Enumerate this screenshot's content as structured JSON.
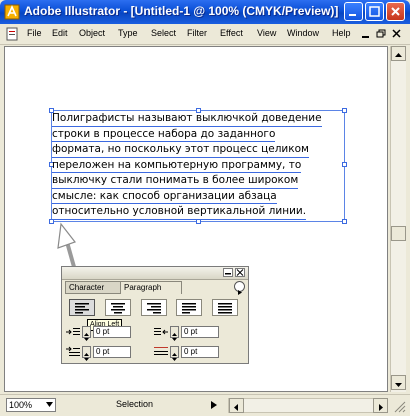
{
  "window": {
    "title": "Adobe Illustrator - [Untitled-1 @ 100% (CMYK/Preview)]"
  },
  "menu": {
    "items": [
      "File",
      "Edit",
      "Object",
      "Type",
      "Select",
      "Filter",
      "Effect",
      "View",
      "Window",
      "Help"
    ]
  },
  "document": {
    "lines": [
      "Полиграфисты называют выключкой доведение",
      "строки в процессе набора до заданного",
      "формата, но поскольку этот процесс целиком",
      "переложен на компьютерную программу, то",
      "выключку стали понимать в более широком",
      "смысле: как способ организации абзаца",
      "относительно условной вертикальной линии."
    ]
  },
  "palette": {
    "tab_character": "Character",
    "tab_paragraph": "Paragraph",
    "tooltip": "Align Left",
    "fields": [
      {
        "value": "0 pt"
      },
      {
        "value": "0 pt"
      },
      {
        "value": "0 pt"
      },
      {
        "value": "0 pt"
      }
    ]
  },
  "status": {
    "zoom": "100%",
    "tool": "Selection"
  },
  "colors": {
    "titlebar": "#0a4fd6",
    "selection": "#3c6ae0"
  }
}
